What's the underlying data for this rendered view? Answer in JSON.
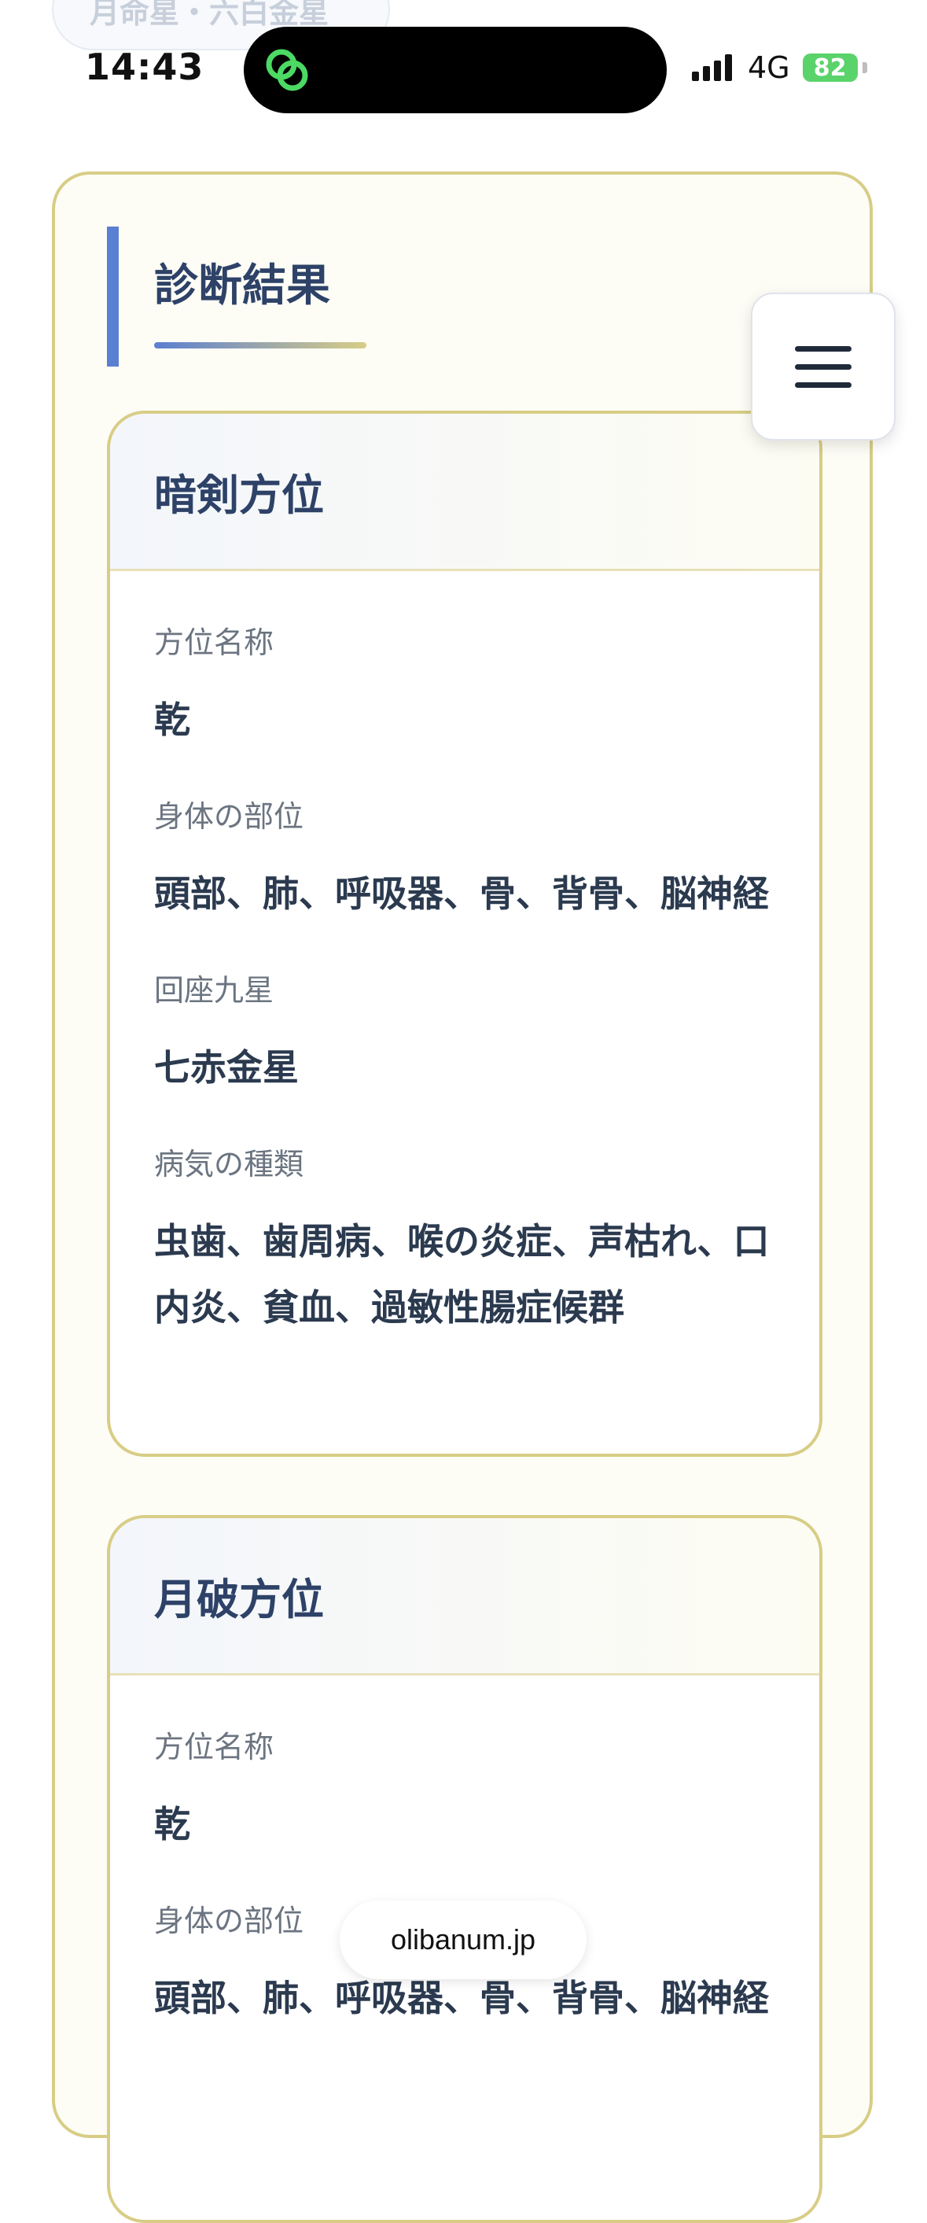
{
  "top_pill": {
    "text": "月命星・六白金星"
  },
  "status_bar": {
    "time": "14:43",
    "network": "4G",
    "battery": "82"
  },
  "section": {
    "title": "診断結果"
  },
  "cards": [
    {
      "title": "暗剣方位",
      "fields": [
        {
          "label": "方位名称",
          "value": "乾"
        },
        {
          "label": "身体の部位",
          "value": "頭部、肺、呼吸器、骨、背骨、脳神経"
        },
        {
          "label": "回座九星",
          "value": "七赤金星"
        },
        {
          "label": "病気の種類",
          "value": "虫歯、歯周病、喉の炎症、声枯れ、口内炎、貧血、過敏性腸症候群"
        }
      ]
    },
    {
      "title": "月破方位",
      "fields": [
        {
          "label": "方位名称",
          "value": "乾"
        },
        {
          "label": "身体の部位",
          "value": "頭部、肺、呼吸器、骨、背骨、脳神経"
        }
      ]
    }
  ],
  "browser": {
    "domain": "olibanum.jp"
  },
  "icons": {
    "island_app": "link-rings-icon",
    "menu": "hamburger-menu-icon"
  },
  "colors": {
    "accent_blue": "#5b7fd1",
    "border_gold": "#d8cd86",
    "title_navy": "#2e4268",
    "island_icon_green": "#4cd964"
  }
}
